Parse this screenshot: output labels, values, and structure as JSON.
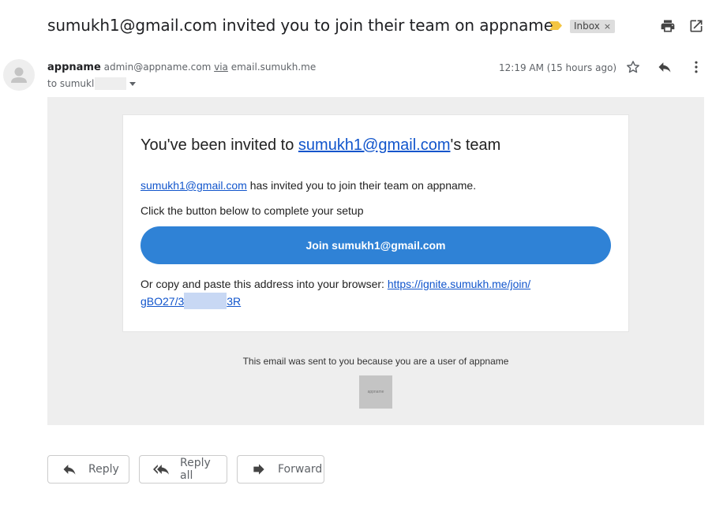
{
  "subject": {
    "text": "sumukh1@gmail.com invited you to join their team on appname",
    "label": "Inbox",
    "label_remove": "×",
    "importance_color": "#f4c542"
  },
  "icons": {
    "print": "print-icon",
    "popout": "open-in-new-window-icon",
    "star": "star-icon",
    "reply": "reply-icon",
    "more": "more-vert-icon",
    "avatar": "default-avatar-icon",
    "reply_all": "reply-all-icon",
    "forward": "forward-icon"
  },
  "header": {
    "sender_name": "appname",
    "sender_email": "admin@appname.com",
    "via_label": "via",
    "via_domain": "email.sumukh.me",
    "to_label": "to sumukl",
    "timestamp": "12:19 AM (15 hours ago)"
  },
  "email": {
    "title_prefix": "You've been invited to ",
    "title_link": "sumukh1@gmail.com",
    "title_suffix": "'s team",
    "p1_link": "sumukh1@gmail.com",
    "p1_text": " has invited you to join their team on appname.",
    "p2_text": "Click the button below to complete your setup",
    "button_label": "Join sumukh1@gmail.com",
    "p3_text": "Or copy and paste this address into your browser: ",
    "url_part1": "https://ignite.sumukh.me/join/",
    "url_part2": "gBO27/3",
    "url_part3": "3R",
    "footer": "This email was sent to you because you are a user of appname",
    "logo_text": "appname",
    "button_color": "#2f82d6",
    "link_color": "#1155cc"
  },
  "actions": {
    "reply": "Reply",
    "reply_all": "Reply all",
    "forward": "Forward"
  }
}
